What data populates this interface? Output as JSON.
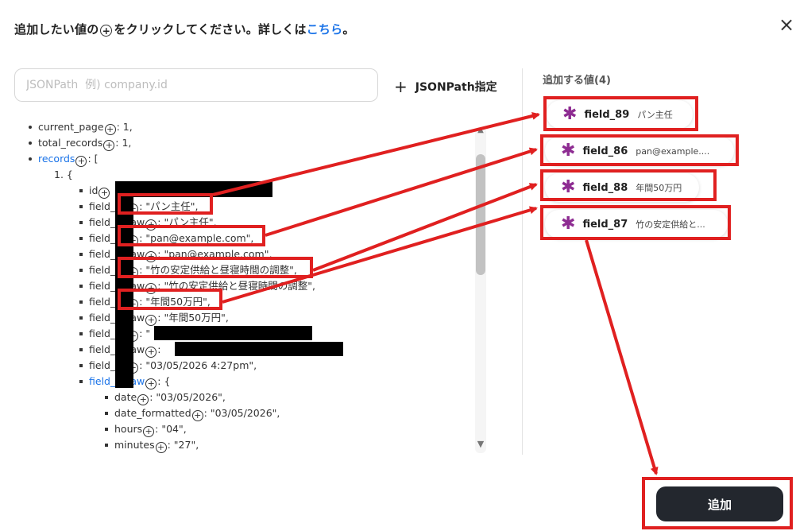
{
  "header": {
    "title_prefix": "追加したい値の",
    "plus_glyph": "+",
    "title_middle": "をクリックしてください。詳しくは",
    "title_link": "こちら",
    "title_suffix": "。",
    "close_glyph": "×"
  },
  "search": {
    "placeholder": "JSONPath  例) company.id",
    "value": ""
  },
  "add_path": {
    "plus": "+",
    "label": "JSONPath指定"
  },
  "tree": {
    "plus": "+",
    "current_page": {
      "key": "current_page",
      "value": ": 1,"
    },
    "total_records": {
      "key": "total_records",
      "value": ": 1,"
    },
    "records": {
      "key": "records",
      "value": ": ["
    },
    "item_index": "1. {",
    "id": {
      "key": "id",
      "value": ","
    },
    "f1": {
      "key": "field_",
      "value": ": \"パン主任\","
    },
    "f1raw": {
      "key": "field_",
      "suffix": "raw",
      "value": ": \"パン主任\","
    },
    "f2": {
      "key": "field_",
      "value": ": \"pan@example.com\","
    },
    "f2raw": {
      "key": "field_",
      "suffix": "raw",
      "value": ": \"pan@example.com\","
    },
    "f3": {
      "key": "field_",
      "value": ": \"竹の安定供給と昼寝時間の調整\","
    },
    "f3raw": {
      "key": "field_",
      "suffix": "raw",
      "value": ": \"竹の安定供給と昼寝時間の調整\","
    },
    "f4": {
      "key": "field_",
      "value": ": \"年間50万円\","
    },
    "f4raw": {
      "key": "field_",
      "suffix": "raw",
      "value": ": \"年間50万円\","
    },
    "f5": {
      "key": "field_",
      "value": ": \""
    },
    "f5raw": {
      "key": "field_",
      "suffix": "raw",
      "value": ":"
    },
    "f6": {
      "key": "field_",
      "value": ": \"03/05/2026 4:27pm\","
    },
    "f6raw": {
      "key": "field_",
      "suffix": "raw",
      "value": ": {"
    },
    "date": {
      "key": "date",
      "value": ": \"03/05/2026\","
    },
    "date_formatted": {
      "key": "date_formatted",
      "value": ": \"03/05/2026\","
    },
    "hours": {
      "key": "hours",
      "value": ": \"04\","
    },
    "minutes": {
      "key": "minutes",
      "value": ": \"27\","
    }
  },
  "scrollbar": {
    "up": "▲",
    "down": "▼"
  },
  "selected": {
    "title": "追加する値(4)",
    "asterisk": "✱",
    "items": [
      {
        "name": "field_89",
        "value": "パン主任"
      },
      {
        "name": "field_86",
        "value": "pan@example...."
      },
      {
        "name": "field_88",
        "value": "年間50万円"
      },
      {
        "name": "field_87",
        "value": "竹の安定供給と..."
      }
    ]
  },
  "submit_label": "追加",
  "colors": {
    "annotation_red": "#e02020",
    "asterisk": "#8e2c92",
    "link": "#1a73e8",
    "button": "#23272e"
  }
}
